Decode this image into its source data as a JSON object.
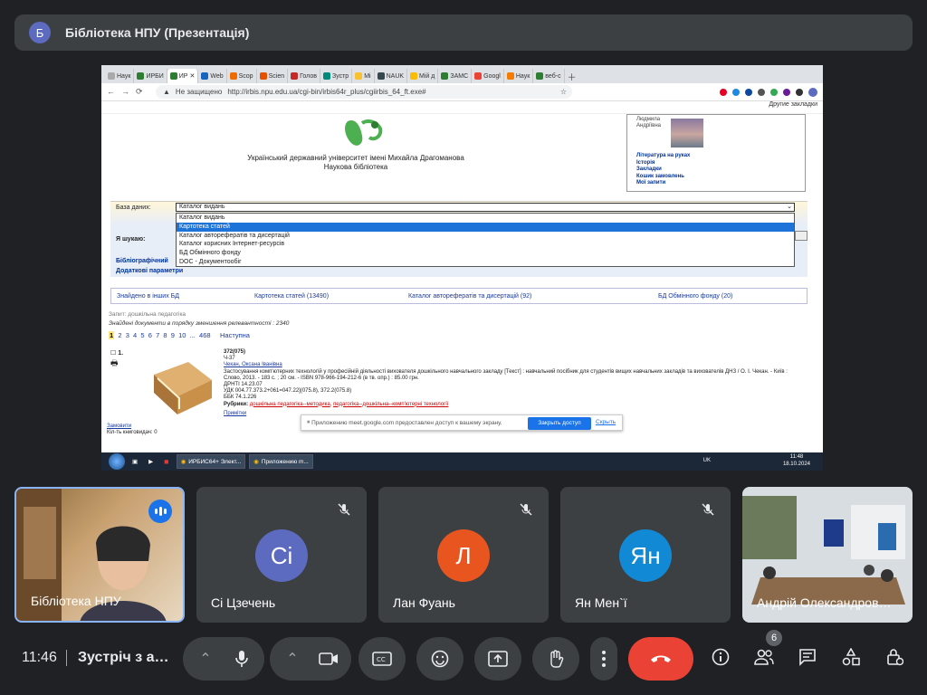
{
  "meeting": {
    "presenter_initial": "Б",
    "presentation_title": "Бібліотека НПУ (Презентація)",
    "time": "11:46",
    "meeting_name": "Зустріч з а…",
    "participant_count": "6"
  },
  "browser": {
    "tabs": [
      "Наук",
      "ИРБИ",
      "ИР",
      "Web",
      "Scop",
      "Scien",
      "Голов",
      "Зустр",
      "Mi",
      "NAUK",
      "Мій д",
      "ЗАМС",
      "Googl",
      "Наук",
      "веб-с"
    ],
    "insecure_label": "Не защищено",
    "url": "http://irbis.npu.edu.ua/cgi-bin/irbis64r_plus/cgiirbis_64_ft.exe#",
    "bookmarks_label": "Другие закладки",
    "profile_initial": "Б"
  },
  "page": {
    "university": "Український державний університет імені Михайла Драгоманова",
    "library": "Наукова бібліотека",
    "user_name": "Людмила Андріївна",
    "side_links": [
      "Література на руках",
      "Історія",
      "Закладки",
      "Кошик замовлень",
      "Мої запити"
    ],
    "db_label": "База даних:",
    "db_selected": "Каталог видань",
    "db_options": [
      "Каталог видань",
      "Картотека статей",
      "Каталог авторефератів та дисертацій",
      "Каталог корисних Інтернет-ресурсів",
      "БД Обмінного фонду",
      "DOC - Документообіг"
    ],
    "search_label": "Я шукаю:",
    "biblio_label": "Бібліографічний",
    "extra_params": "Додаткові параметри",
    "found_other": "Знайдено в інших БД",
    "found_links": [
      "Картотека статей (13490)",
      "Каталог авторефератів та дисертацій (92)",
      "БД Обмінного фонду (20)"
    ],
    "query": "Запит: дошкільна педагогіка",
    "found_text": "Знайдені документи в порядку зменшення релевантності : 2340",
    "pagination": [
      "1",
      "2",
      "3",
      "4",
      "5",
      "6",
      "7",
      "8",
      "9",
      "10",
      "...",
      "468",
      "Наступна"
    ],
    "record": {
      "num": "1.",
      "code1": "372(075)",
      "code2": "Ч-37",
      "author": "Чекан, Оксана Іванівна",
      "title": "Застосування комп'ютерних технологій у професійній діяльності вихователя дошкільного навчального закладу [Текст] : навчальний посібник для студентів вищих навчальних закладів та вихователів ДНЗ / О. І. Чекан. - Київ : Слово, 2013. - 183 с. ; 20 см. - ISBN 978-966-194-212-6 (в тв. опр.) : 85.00 грн.",
      "grnti": "ДРНТІ 14.23.07",
      "udk": "УДК 004.77.373.2+061=047.22](075.8), 372.2(075.8)",
      "bbk": "ББК 74.1.226",
      "rubrics_label": "Рубрики:",
      "rubric1": "дошкільна педагогіка--методика",
      "rubric2": "педагогіка--дошкільна--комп'ютерні технології",
      "notes": "Примітки",
      "order": "Замовити",
      "copies": "Кіл-ть книговидач: 0"
    },
    "notice_text": "Приложению meet.google.com предоставлен доступ к вашему экрану.",
    "notice_ok": "Закрыть доступ",
    "notice_hide": "Скрыть"
  },
  "taskbar": {
    "items": [
      "ИРБИС64+ Элект...",
      "Приложению m..."
    ],
    "lang": "UK",
    "clock_time": "11:48",
    "clock_date": "18.10.2024"
  },
  "tiles": [
    {
      "name": "Бібліотека НПУ",
      "initials": ""
    },
    {
      "name": "Сі Цзечень",
      "initials": "Сі",
      "color": "#5c6bc0"
    },
    {
      "name": "Лан Фуань",
      "initials": "Л",
      "color": "#e8551f"
    },
    {
      "name": "Ян Мен`ї",
      "initials": "Ян",
      "color": "#1289d4"
    },
    {
      "name": "Андрій Олександров…",
      "initials": ""
    }
  ],
  "colors": {
    "end_call": "#ea4335",
    "accent": "#8ab4f8"
  }
}
